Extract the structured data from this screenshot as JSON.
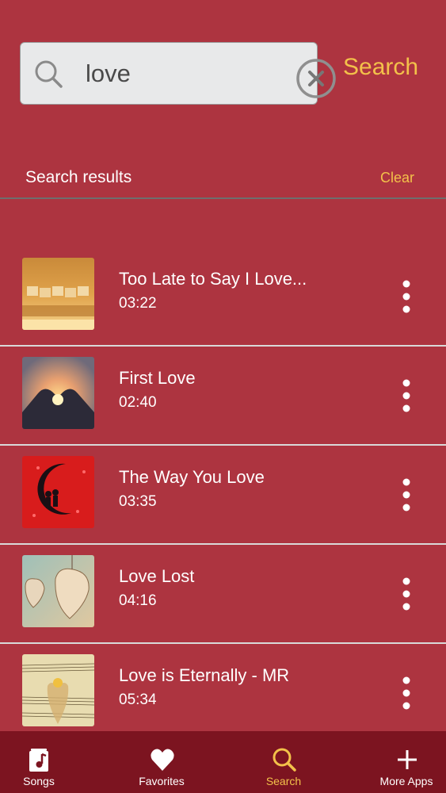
{
  "search": {
    "value": "love",
    "button_label": "Search"
  },
  "results": {
    "title": "Search results",
    "clear_label": "Clear"
  },
  "songs": [
    {
      "title": "Too Late to Say I Love...",
      "duration": "03:22",
      "thumb": "scrabble-love-tiles"
    },
    {
      "title": "First Love",
      "duration": "02:40",
      "thumb": "heart-hands-sunset"
    },
    {
      "title": "The Way You Love",
      "duration": "03:35",
      "thumb": "couple-on-moon"
    },
    {
      "title": "Love Lost",
      "duration": "04:16",
      "thumb": "wooden-hearts"
    },
    {
      "title": "Love is Eternally - MR",
      "duration": "05:34",
      "thumb": "sheet-music-heart"
    }
  ],
  "tabs": [
    {
      "label": "Songs",
      "icon": "music-note-icon",
      "active": false
    },
    {
      "label": "Favorites",
      "icon": "heart-icon",
      "active": false
    },
    {
      "label": "Search",
      "icon": "search-icon",
      "active": true
    },
    {
      "label": "More Apps",
      "icon": "plus-icon",
      "active": false
    }
  ],
  "colors": {
    "background": "#ad3440",
    "accent": "#f3c14a",
    "tabbar": "#7c1420"
  }
}
